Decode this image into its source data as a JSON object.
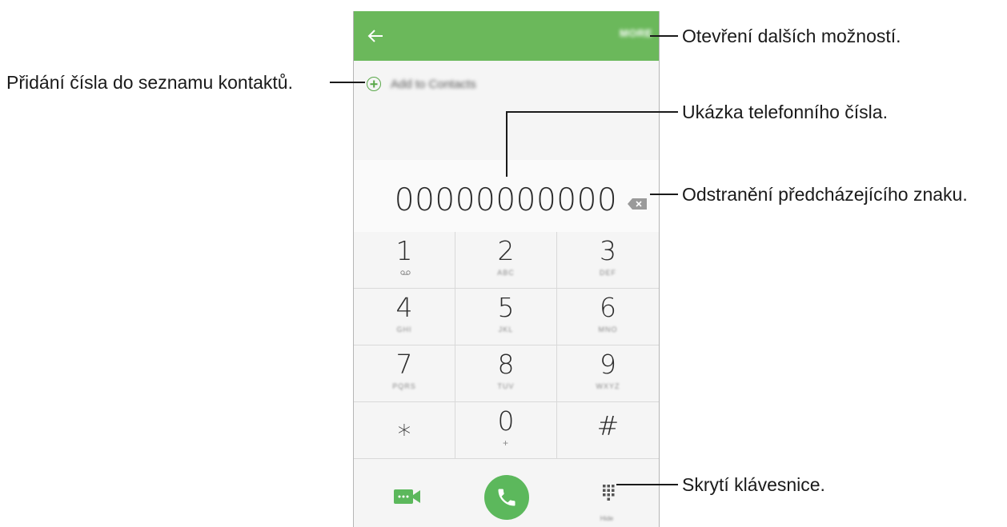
{
  "phone": {
    "more_label": "MORE",
    "add_contacts_label": "Add to Contacts",
    "number_display": "00000000000",
    "keys": [
      {
        "digit": "1",
        "sub": ""
      },
      {
        "digit": "2",
        "sub": "ABC"
      },
      {
        "digit": "3",
        "sub": "DEF"
      },
      {
        "digit": "4",
        "sub": "GHI"
      },
      {
        "digit": "5",
        "sub": "JKL"
      },
      {
        "digit": "6",
        "sub": "MNO"
      },
      {
        "digit": "7",
        "sub": "PQRS"
      },
      {
        "digit": "8",
        "sub": "TUV"
      },
      {
        "digit": "9",
        "sub": "WXYZ"
      },
      {
        "digit": "⁎",
        "sub": ""
      },
      {
        "digit": "0",
        "sub": "+"
      },
      {
        "digit": "#",
        "sub": ""
      }
    ],
    "hide_label": "Hide",
    "accent_color": "#6bb85b",
    "call_color": "#5cb85c"
  },
  "callouts": {
    "more_options": "Otevření dalších možností.",
    "add_to_contacts": "Přidání čísla do seznamu kontaktů.",
    "number_preview": "Ukázka telefonního čísla.",
    "delete_char": "Odstranění předcházejícího znaku.",
    "hide_keypad": "Skrytí klávesnice."
  }
}
